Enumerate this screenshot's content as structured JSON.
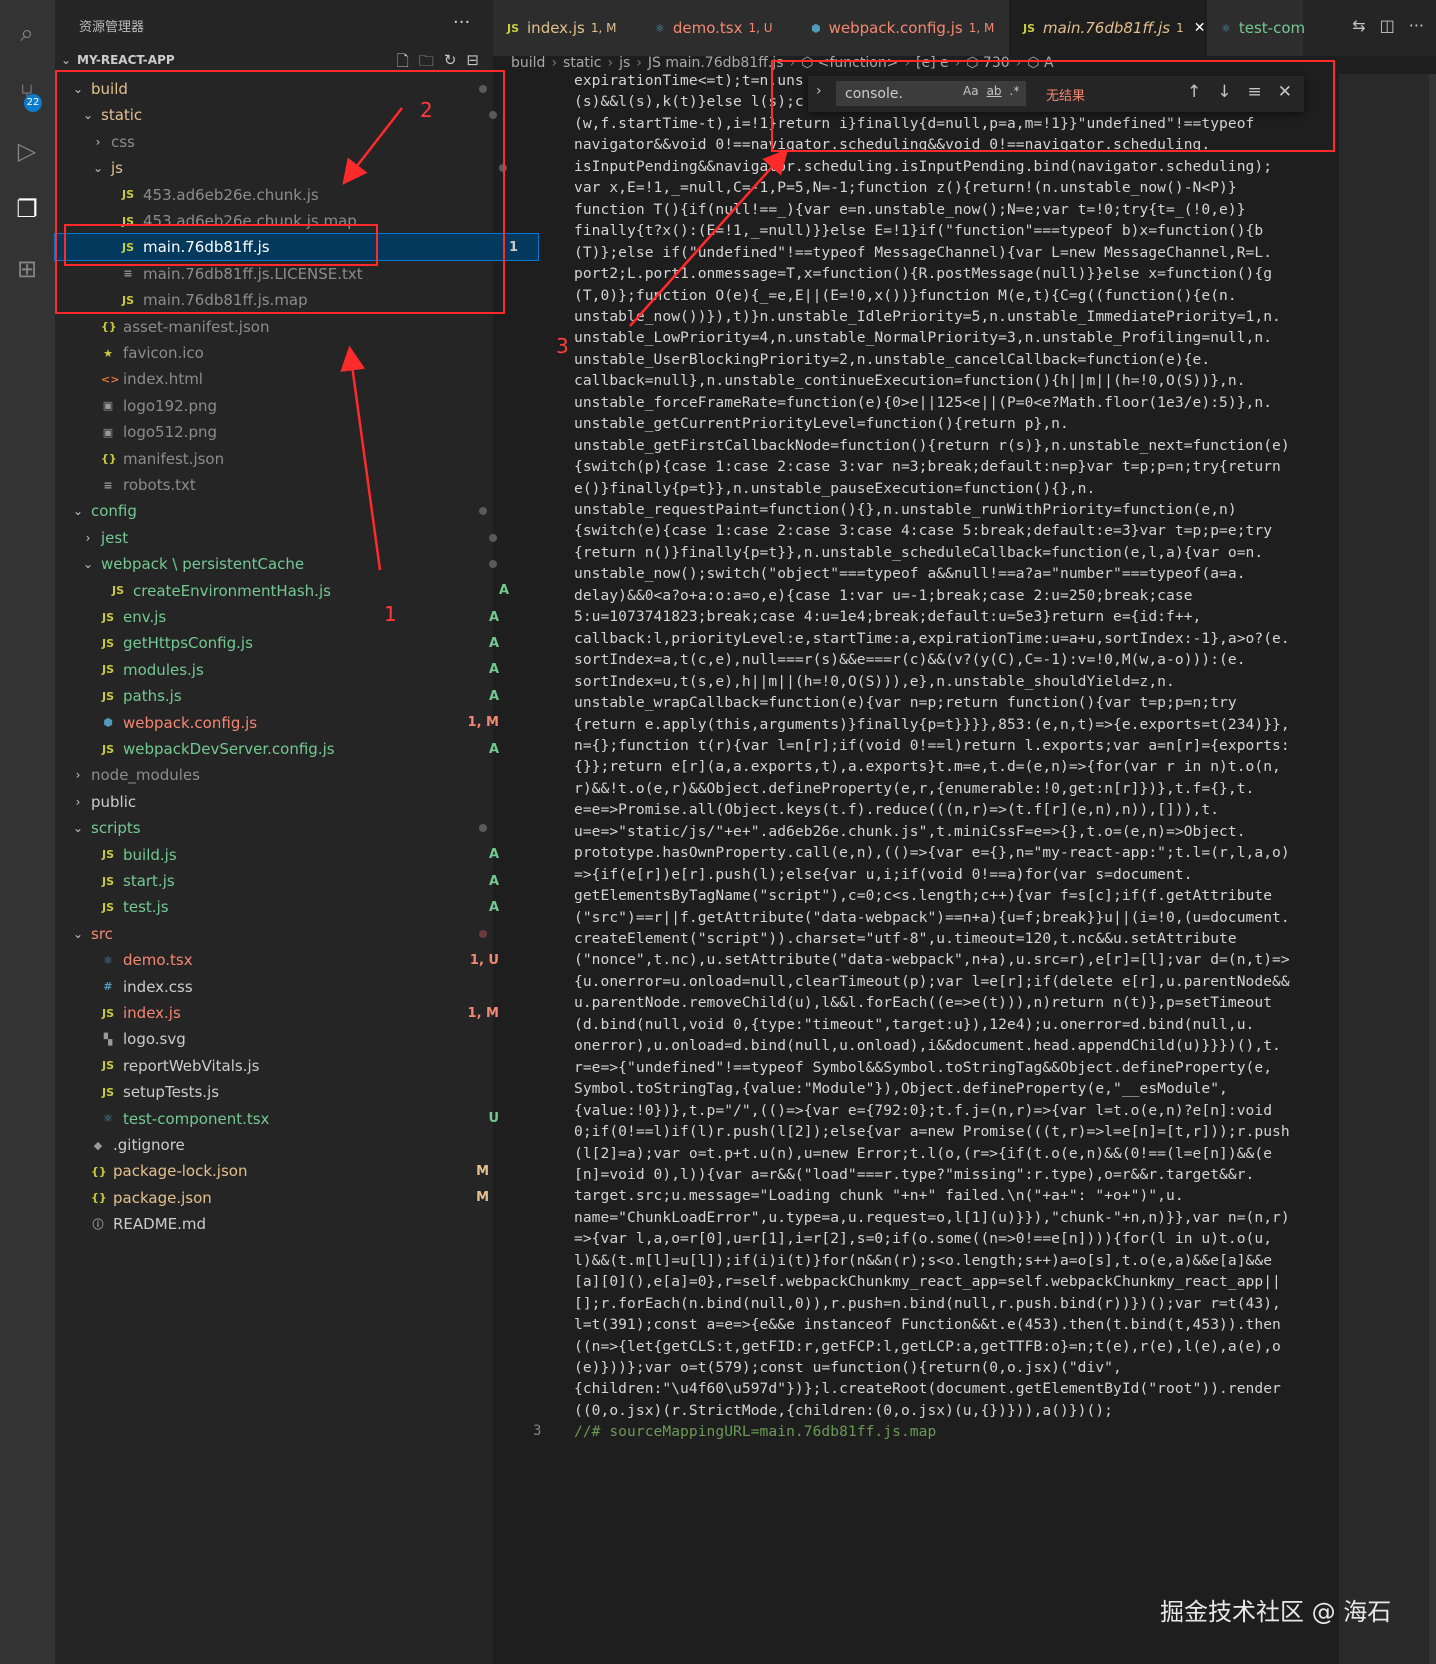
{
  "activity": {
    "scm_badge": "22"
  },
  "sidebar": {
    "title": "资源管理器",
    "more": "···",
    "project": "MY-REACT-APP",
    "rows": [
      {
        "name": "build",
        "indent": 0,
        "chev": "⌄",
        "icon": "",
        "cls": "c-modified",
        "dot": true
      },
      {
        "name": "static",
        "indent": 1,
        "chev": "⌄",
        "icon": "",
        "cls": "c-modified",
        "dot": true
      },
      {
        "name": "css",
        "indent": 2,
        "chev": "›",
        "icon": "",
        "cls": "c-dim"
      },
      {
        "name": "js",
        "indent": 2,
        "chev": "⌄",
        "icon": "",
        "cls": "c-modified",
        "dot": true
      },
      {
        "name": "453.ad6eb26e.chunk.js",
        "indent": 3,
        "chev": "",
        "icon": "JS",
        "cls": "c-dim"
      },
      {
        "name": "453.ad6eb26e.chunk.js.map",
        "indent": 3,
        "chev": "",
        "icon": "JS",
        "cls": "c-dim"
      },
      {
        "name": "main.76db81ff.js",
        "indent": 3,
        "chev": "",
        "icon": "JS",
        "cls": "c-white",
        "status": "1",
        "selected": true
      },
      {
        "name": "main.76db81ff.js.LICENSE.txt",
        "indent": 3,
        "chev": "",
        "icon": "≡",
        "cls": "c-dim"
      },
      {
        "name": "main.76db81ff.js.map",
        "indent": 3,
        "chev": "",
        "icon": "JS",
        "cls": "c-dim"
      },
      {
        "name": "asset-manifest.json",
        "indent": 1,
        "chev": "",
        "icon": "{}",
        "cls": "c-dim"
      },
      {
        "name": "favicon.ico",
        "indent": 1,
        "chev": "",
        "icon": "★",
        "cls": "c-dim"
      },
      {
        "name": "index.html",
        "indent": 1,
        "chev": "",
        "icon": "<>",
        "cls": "c-dim"
      },
      {
        "name": "logo192.png",
        "indent": 1,
        "chev": "",
        "icon": "▣",
        "cls": "c-dim"
      },
      {
        "name": "logo512.png",
        "indent": 1,
        "chev": "",
        "icon": "▣",
        "cls": "c-dim"
      },
      {
        "name": "manifest.json",
        "indent": 1,
        "chev": "",
        "icon": "{}",
        "cls": "c-dim"
      },
      {
        "name": "robots.txt",
        "indent": 1,
        "chev": "",
        "icon": "≡",
        "cls": "c-dim"
      },
      {
        "name": "config",
        "indent": 0,
        "chev": "⌄",
        "icon": "",
        "cls": "c-added",
        "dot": true
      },
      {
        "name": "jest",
        "indent": 1,
        "chev": "›",
        "icon": "",
        "cls": "c-added",
        "dot": true
      },
      {
        "name": "webpack \\ persistentCache",
        "indent": 1,
        "chev": "⌄",
        "icon": "",
        "cls": "c-added",
        "dot": true
      },
      {
        "name": "createEnvironmentHash.js",
        "indent": 2,
        "chev": "",
        "icon": "JS",
        "cls": "c-added",
        "status": "A"
      },
      {
        "name": "env.js",
        "indent": 1,
        "chev": "",
        "icon": "JS",
        "cls": "c-added",
        "status": "A"
      },
      {
        "name": "getHttpsConfig.js",
        "indent": 1,
        "chev": "",
        "icon": "JS",
        "cls": "c-added",
        "status": "A"
      },
      {
        "name": "modules.js",
        "indent": 1,
        "chev": "",
        "icon": "JS",
        "cls": "c-added",
        "status": "A"
      },
      {
        "name": "paths.js",
        "indent": 1,
        "chev": "",
        "icon": "JS",
        "cls": "c-added",
        "status": "A"
      },
      {
        "name": "webpack.config.js",
        "indent": 1,
        "chev": "",
        "icon": "⬢",
        "cls": "c-error",
        "status": "1, M"
      },
      {
        "name": "webpackDevServer.config.js",
        "indent": 1,
        "chev": "",
        "icon": "JS",
        "cls": "c-added",
        "status": "A"
      },
      {
        "name": "node_modules",
        "indent": 0,
        "chev": "›",
        "icon": "",
        "cls": "c-dim"
      },
      {
        "name": "public",
        "indent": 0,
        "chev": "›",
        "icon": "",
        "cls": "c-white"
      },
      {
        "name": "scripts",
        "indent": 0,
        "chev": "⌄",
        "icon": "",
        "cls": "c-added",
        "dot": true
      },
      {
        "name": "build.js",
        "indent": 1,
        "chev": "",
        "icon": "JS",
        "cls": "c-added",
        "status": "A"
      },
      {
        "name": "start.js",
        "indent": 1,
        "chev": "",
        "icon": "JS",
        "cls": "c-added",
        "status": "A"
      },
      {
        "name": "test.js",
        "indent": 1,
        "chev": "",
        "icon": "JS",
        "cls": "c-added",
        "status": "A"
      },
      {
        "name": "src",
        "indent": 0,
        "chev": "⌄",
        "icon": "",
        "cls": "c-error",
        "dotRed": true
      },
      {
        "name": "demo.tsx",
        "indent": 1,
        "chev": "",
        "icon": "⚛",
        "cls": "c-error",
        "status": "1, U"
      },
      {
        "name": "index.css",
        "indent": 1,
        "chev": "",
        "icon": "#",
        "cls": "c-white"
      },
      {
        "name": "index.js",
        "indent": 1,
        "chev": "",
        "icon": "JS",
        "cls": "c-error",
        "status": "1, M"
      },
      {
        "name": "logo.svg",
        "indent": 1,
        "chev": "",
        "icon": "▚",
        "cls": "c-white"
      },
      {
        "name": "reportWebVitals.js",
        "indent": 1,
        "chev": "",
        "icon": "JS",
        "cls": "c-white"
      },
      {
        "name": "setupTests.js",
        "indent": 1,
        "chev": "",
        "icon": "JS",
        "cls": "c-white"
      },
      {
        "name": "test-component.tsx",
        "indent": 1,
        "chev": "",
        "icon": "⚛",
        "cls": "c-untracked",
        "status": "U"
      },
      {
        "name": ".gitignore",
        "indent": 0,
        "chev": "",
        "icon": "◆",
        "cls": "c-white"
      },
      {
        "name": "package-lock.json",
        "indent": 0,
        "chev": "",
        "icon": "{}",
        "cls": "c-modified",
        "status": "M"
      },
      {
        "name": "package.json",
        "indent": 0,
        "chev": "",
        "icon": "{}",
        "cls": "c-modified",
        "status": "M"
      },
      {
        "name": "README.md",
        "indent": 0,
        "chev": "",
        "icon": "ⓘ",
        "cls": "c-white"
      }
    ]
  },
  "tabs": [
    {
      "icon": "JS",
      "label": "index.js",
      "status": "1, M",
      "cls": "c-modified",
      "active": false
    },
    {
      "icon": "⚛",
      "label": "demo.tsx",
      "status": "1, U",
      "cls": "c-error",
      "active": false
    },
    {
      "icon": "⬢",
      "label": "webpack.config.js",
      "status": "1, M",
      "cls": "c-error",
      "active": false
    },
    {
      "icon": "JS",
      "label": "main.76db81ff.js",
      "status": "1",
      "cls": "c-modified",
      "active": true
    },
    {
      "icon": "⚛",
      "label": "test-com",
      "status": "",
      "cls": "c-untracked",
      "active": false
    }
  ],
  "breadcrumb": [
    "build",
    "static",
    "js",
    "JS main.76db81ff.js",
    "⬡ <function>",
    "[e] e",
    "⬡ 730",
    "⬡ A"
  ],
  "find": {
    "value": "console.",
    "result": "无结果",
    "opt_case": "Aa",
    "opt_word": "ab",
    "opt_regex": ".*"
  },
  "code": [
    "expirationTime<=t);t=n.uns",
    "(s)&&l(s),k(t)}else l(s);c",
    "(w,f.startTime-t),i=!1}return i}finally{d=null,p=a,m=!1}}\"undefined\"!==typeof",
    "navigator&&void 0!==navigator.scheduling&&void 0!==navigator.scheduling.",
    "isInputPending&&navigator.scheduling.isInputPending.bind(navigator.scheduling);",
    "var x,E=!1,_=null,C=-1,P=5,N=-1;function z(){return!(n.unstable_now()-N<P)}",
    "function T(){if(null!==_){var e=n.unstable_now();N=e;var t=!0;try{t=_(!0,e)}",
    "finally{t?x():(E=!1,_=null)}}else E=!1}if(\"function\"===typeof b)x=function(){b",
    "(T)};else if(\"undefined\"!==typeof MessageChannel){var L=new MessageChannel,R=L.",
    "port2;L.port1.onmessage=T,x=function(){R.postMessage(null)}}else x=function(){g",
    "(T,0)};function O(e){_=e,E||(E=!0,x())}function M(e,t){C=g((function(){e(n.",
    "unstable_now())}),t)}n.unstable_IdlePriority=5,n.unstable_ImmediatePriority=1,n.",
    "unstable_LowPriority=4,n.unstable_NormalPriority=3,n.unstable_Profiling=null,n.",
    "unstable_UserBlockingPriority=2,n.unstable_cancelCallback=function(e){e.",
    "callback=null},n.unstable_continueExecution=function(){h||m||(h=!0,O(S))},n.",
    "unstable_forceFrameRate=function(e){0>e||125<e||(P=0<e?Math.floor(1e3/e):5)},n.",
    "unstable_getCurrentPriorityLevel=function(){return p},n.",
    "unstable_getFirstCallbackNode=function(){return r(s)},n.unstable_next=function(e)",
    "{switch(p){case 1:case 2:case 3:var n=3;break;default:n=p}var t=p;p=n;try{return",
    "e()}finally{p=t}},n.unstable_pauseExecution=function(){},n.",
    "unstable_requestPaint=function(){},n.unstable_runWithPriority=function(e,n)",
    "{switch(e){case 1:case 2:case 3:case 4:case 5:break;default:e=3}var t=p;p=e;try",
    "{return n()}finally{p=t}},n.unstable_scheduleCallback=function(e,l,a){var o=n.",
    "unstable_now();switch(\"object\"===typeof a&&null!==a?a=\"number\"===typeof(a=a.",
    "delay)&&0<a?o+a:o:a=o,e){case 1:var u=-1;break;case 2:u=250;break;case",
    "5:u=1073741823;break;case 4:u=1e4;break;default:u=5e3}return e={id:f++,",
    "callback:l,priorityLevel:e,startTime:a,expirationTime:u=a+u,sortIndex:-1},a>o?(e.",
    "sortIndex=a,t(c,e),null===r(s)&&e===r(c)&&(v?(y(C),C=-1):v=!0,M(w,a-o))):(e.",
    "sortIndex=u,t(s,e),h||m||(h=!0,O(S))),e},n.unstable_shouldYield=z,n.",
    "unstable_wrapCallback=function(e){var n=p;return function(){var t=p;p=n;try",
    "{return e.apply(this,arguments)}finally{p=t}}}},853:(e,n,t)=>{e.exports=t(234)}},",
    "n={};function t(r){var l=n[r];if(void 0!==l)return l.exports;var a=n[r]={exports:",
    "{}};return e[r](a,a.exports,t),a.exports}t.m=e,t.d=(e,n)=>{for(var r in n)t.o(n,",
    "r)&&!t.o(e,r)&&Object.defineProperty(e,r,{enumerable:!0,get:n[r]})},t.f={},t.",
    "e=e=>Promise.all(Object.keys(t.f).reduce(((n,r)=>(t.f[r](e,n),n)),[])),t.",
    "u=e=>\"static/js/\"+e+\".ad6eb26e.chunk.js\",t.miniCssF=e=>{},t.o=(e,n)=>Object.",
    "prototype.hasOwnProperty.call(e,n),(()=>{var e={},n=\"my-react-app:\";t.l=(r,l,a,o)",
    "=>{if(e[r])e[r].push(l);else{var u,i;if(void 0!==a)for(var s=document.",
    "getElementsByTagName(\"script\"),c=0;c<s.length;c++){var f=s[c];if(f.getAttribute",
    "(\"src\")==r||f.getAttribute(\"data-webpack\")==n+a){u=f;break}}u||(i=!0,(u=document.",
    "createElement(\"script\")).charset=\"utf-8\",u.timeout=120,t.nc&&u.setAttribute",
    "(\"nonce\",t.nc),u.setAttribute(\"data-webpack\",n+a),u.src=r),e[r]=[l];var d=(n,t)=>",
    "{u.onerror=u.onload=null,clearTimeout(p);var l=e[r];if(delete e[r],u.parentNode&&",
    "u.parentNode.removeChild(u),l&&l.forEach((e=>e(t))),n)return n(t)},p=setTimeout",
    "(d.bind(null,void 0,{type:\"timeout\",target:u}),12e4);u.onerror=d.bind(null,u.",
    "onerror),u.onload=d.bind(null,u.onload),i&&document.head.appendChild(u)}}})(),t.",
    "r=e=>{\"undefined\"!==typeof Symbol&&Symbol.toStringTag&&Object.defineProperty(e,",
    "Symbol.toStringTag,{value:\"Module\"}),Object.defineProperty(e,\"__esModule\",",
    "{value:!0})},t.p=\"/\",(()=>{var e={792:0};t.f.j=(n,r)=>{var l=t.o(e,n)?e[n]:void",
    "0;if(0!==l)if(l)r.push(l[2]);else{var a=new Promise(((t,r)=>l=e[n]=[t,r]));r.push",
    "(l[2]=a);var o=t.p+t.u(n),u=new Error;t.l(o,(r=>{if(t.o(e,n)&&(0!==(l=e[n])&&(e",
    "[n]=void 0),l)){var a=r&&(\"load\"===r.type?\"missing\":r.type),o=r&&r.target&&r.",
    "target.src;u.message=\"Loading chunk \"+n+\" failed.\\n(\"+a+\": \"+o+\")\",u.",
    "name=\"ChunkLoadError\",u.type=a,u.request=o,l[1](u)}}),\"chunk-\"+n,n)}},var n=(n,r)",
    "=>{var l,a,o=r[0],u=r[1],i=r[2],s=0;if(o.some((n=>0!==e[n]))){for(l in u)t.o(u,",
    "l)&&(t.m[l]=u[l]);if(i)i(t)}for(n&&n(r);s<o.length;s++)a=o[s],t.o(e,a)&&e[a]&&e",
    "[a][0](),e[a]=0},r=self.webpackChunkmy_react_app=self.webpackChunkmy_react_app||",
    "[];r.forEach(n.bind(null,0)),r.push=n.bind(null,r.push.bind(r))})();var r=t(43),",
    "l=t(391);const a=e=>{e&&e instanceof Function&&t.e(453).then(t.bind(t,453)).then",
    "((n=>{let{getCLS:t,getFID:r,getFCP:l,getLCP:a,getTTFB:o}=n;t(e),r(e),l(e),a(e),o",
    "(e)}))};var o=t(579);const u=function(){return(0,o.jsx)(\"div\",",
    "{children:\"\\u4f60\\u597d\"})};l.createRoot(document.getElementById(\"root\")).render",
    "((0,o.jsx)(r.StrictMode,{children:(0,o.jsx)(u,{})})),a()})();"
  ],
  "last_line": {
    "number": "3",
    "text": "//# sourceMappingURL=main.76db81ff.js.map"
  },
  "annotations": {
    "n1": "1",
    "n2": "2",
    "n3": "3"
  },
  "watermark": "掘金技术社区 @ 海石"
}
